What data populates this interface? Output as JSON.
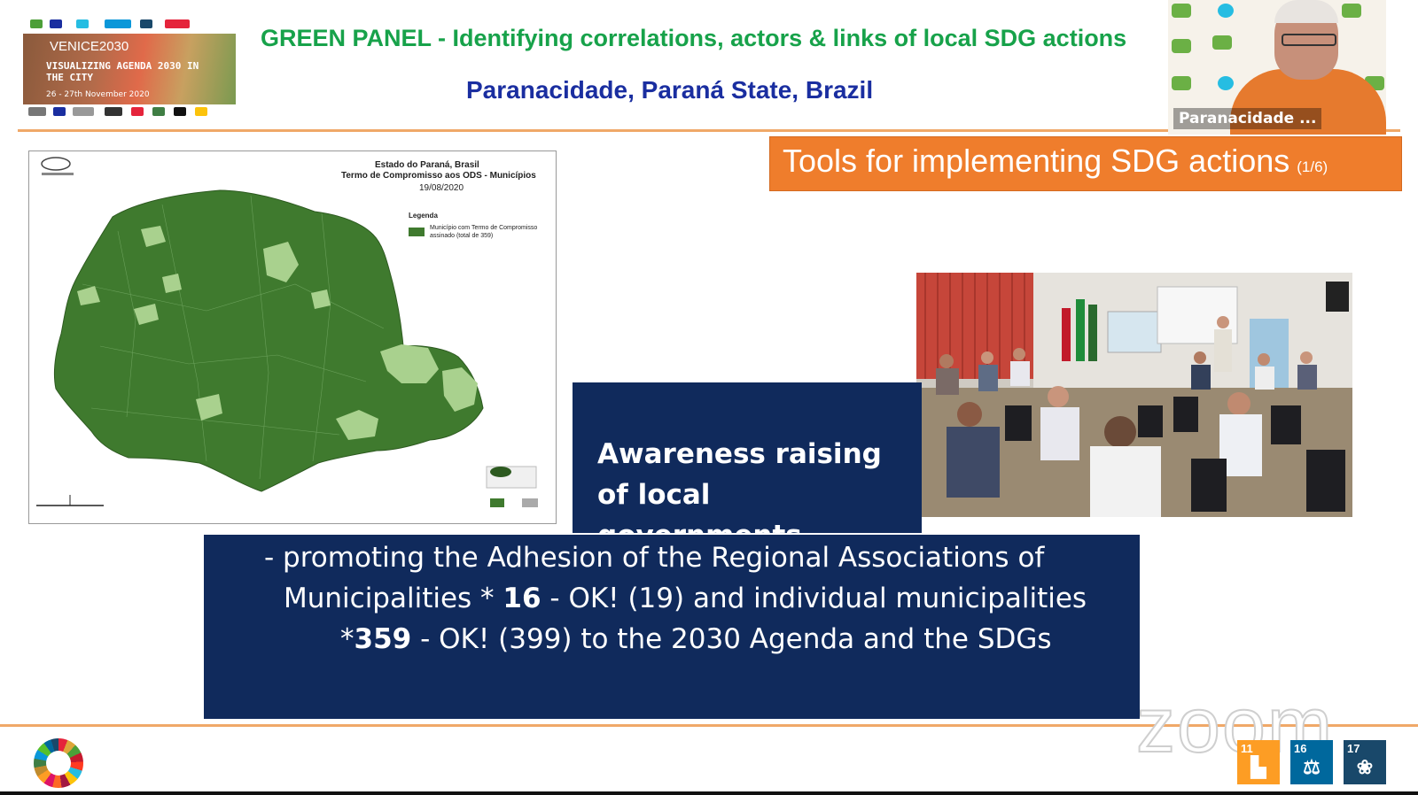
{
  "header": {
    "title": "GREEN PANEL - Identifying correlations, actors & links of local SDG actions",
    "subtitle": "Paranacidade, Paraná State, Brazil",
    "title_color": "#17a24a",
    "subtitle_color": "#1a2ea0"
  },
  "event_logo": {
    "year": "VENICE2030",
    "title": "VISUALIZING AGENDA 2030 IN THE CITY",
    "dates": "26 - 27th November 2020"
  },
  "video_tile": {
    "participant_name": "Paranacidade ..."
  },
  "banner": {
    "text": "Tools for implementing SDG actions",
    "page": "(1/6)",
    "color": "#ef7d2c"
  },
  "map": {
    "title_line1": "Estado do Paraná, Brasil",
    "title_line2": "Termo de Compromisso aos ODS - Municípios",
    "date": "19/08/2020",
    "legend_title": "Legenda",
    "legend_item": "Município com Termo de Compromisso assinado (total de 359)",
    "signed_color": "#3f7a2e",
    "unsigned_color": "#a9d18e"
  },
  "awareness": {
    "text": "Awareness raising of local governments",
    "bg_color": "#102a5c"
  },
  "adhesion": {
    "line1": "-    promoting the Adhesion of the Regional Associations of",
    "line2_a": "Municipalities  * ",
    "line2_b": "16",
    "line2_c": " - OK! (19)  and individual municipalities",
    "line3_a": "*",
    "line3_b": "359",
    "line3_c": " - OK! (399)  to the 2030 Agenda and the SDGs"
  },
  "footer": {
    "watermark": "zoom",
    "sdg_tiles": [
      {
        "num": "11",
        "color": "#fd9d24",
        "icon": "city-icon"
      },
      {
        "num": "16",
        "color": "#00689d",
        "icon": "dove-icon"
      },
      {
        "num": "17",
        "color": "#19486a",
        "icon": "flower-icon"
      }
    ]
  }
}
